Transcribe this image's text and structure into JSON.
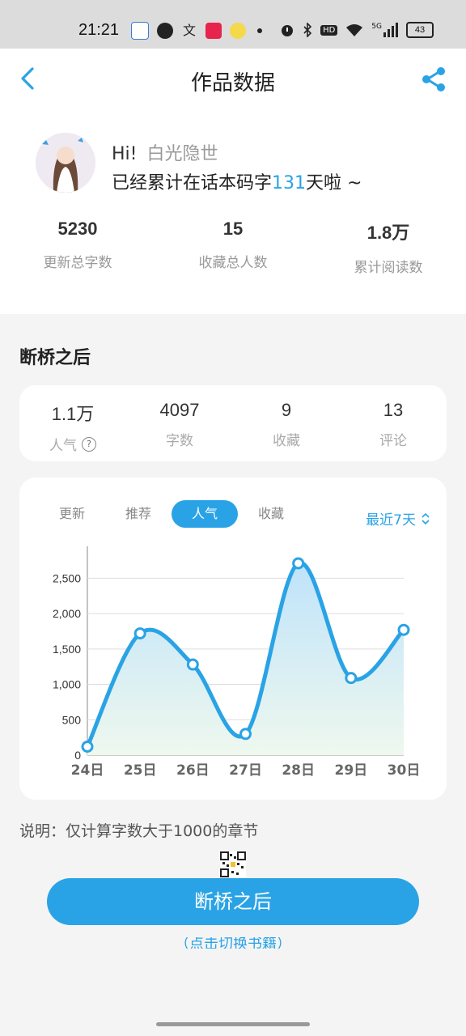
{
  "status_bar": {
    "time": "21:21",
    "network": "5G",
    "battery": "43"
  },
  "header": {
    "title": "作品数据"
  },
  "profile": {
    "greeting": "Hi!",
    "name": "白光隐世",
    "days_prefix": "已经累计在话本码字",
    "days": "131",
    "days_suffix": "天啦 ~",
    "stats": [
      {
        "value": "5230",
        "label": "更新总字数"
      },
      {
        "value": "15",
        "label": "收藏总人数"
      },
      {
        "value": "1.8万",
        "label": "累计阅读数"
      }
    ]
  },
  "book": {
    "title": "断桥之后",
    "stats": [
      {
        "value": "1.1万",
        "label": "人气"
      },
      {
        "value": "4097",
        "label": "字数"
      },
      {
        "value": "9",
        "label": "收藏"
      },
      {
        "value": "13",
        "label": "评论"
      }
    ]
  },
  "chart_tabs": [
    "更新",
    "推荐",
    "人气",
    "收藏"
  ],
  "active_tab": "人气",
  "range_label": "最近7天",
  "colors": {
    "accent": "#2aa3e6",
    "fill_top": "#bfe3fa",
    "fill_bottom": "#eef8ee"
  },
  "chart_data": {
    "type": "line",
    "categories": [
      "24日",
      "25日",
      "26日",
      "27日",
      "28日",
      "29日",
      "30日"
    ],
    "values": [
      120,
      1720,
      1280,
      300,
      2710,
      1090,
      1770
    ],
    "yticks": [
      0,
      500,
      1000,
      1500,
      2000,
      2500
    ],
    "ytick_labels": [
      "0",
      "500",
      "1,000",
      "1,500",
      "2,000",
      "2,500"
    ],
    "ylim": [
      0,
      2950
    ],
    "grid": true,
    "smooth": true
  },
  "note": "说明：仅计算字数大于1000的章节",
  "main_button": "断桥之后",
  "switch_link": "（点击切换书籍）"
}
